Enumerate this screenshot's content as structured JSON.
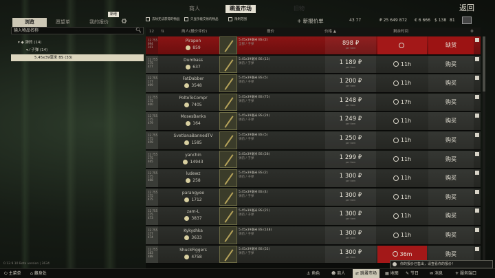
{
  "header": {
    "sub_tabs": [
      "浏览",
      "愿望单",
      "我的报价"
    ],
    "new_badge": "新增",
    "main_tabs": [
      "商人",
      "跳蚤市场",
      "旧物"
    ],
    "filters": [
      "去除无法获得的物品",
      "只显示能交易的物品",
      "限制范围"
    ],
    "wishlist_label": "新报价单",
    "currency": [
      "43 77",
      "₽ 25 649 872",
      "€ 6 666",
      "$ 138",
      "81"
    ],
    "back_label": "返回"
  },
  "sidebar": {
    "search_placeholder": "输入物品名称",
    "tree": [
      {
        "label": "弹药 (14)"
      },
      {
        "label": "子弹 (14)"
      },
      {
        "label": "5.45x39毫米 BS (33)"
      }
    ],
    "version": "0.12.9.10 Beta version | 3634"
  },
  "table": {
    "headers": {
      "level": "12",
      "seller": "商人(报价评价)",
      "item": "报价",
      "price": "价格 ▲",
      "expiry": "剩余时间"
    },
    "rows": [
      {
        "seller": "Pirapon",
        "rep": "859",
        "item": "5.45x39毫米 BS (2)",
        "sub": "全部 / 子弹",
        "price": "898 ₽",
        "time": "",
        "action": "缺货",
        "mine": true,
        "lvl": "12 755 694 101"
      },
      {
        "seller": "Dumbass",
        "rep": "637",
        "item": "5.45x39毫米 BS (13)",
        "sub": "弹药 / 子弹",
        "price": "1 189 ₽",
        "time": "11h",
        "action": "购买",
        "mine": false,
        "lvl": "12 755 175 477"
      },
      {
        "seller": "FatDabber",
        "rep": "3548",
        "item": "5.45x39毫米 BS (5)",
        "sub": "弹药 / 子弹",
        "price": "1 200 ₽",
        "time": "11h",
        "action": "购买",
        "mine": false,
        "lvl": "12 755 177 499"
      },
      {
        "seller": "PoltoToCompr",
        "rep": "7405",
        "item": "5.45x39毫米 BS (75)",
        "sub": "弹药 / 子弹",
        "price": "1 248 ₽",
        "time": "17h",
        "action": "购买",
        "mine": false,
        "lvl": "12 755 175 400"
      },
      {
        "seller": "MosesBanks",
        "rep": "164",
        "item": "5.45x39毫米 BS (24)",
        "sub": "弹药 / 子弹",
        "price": "1 249 ₽",
        "time": "11h",
        "action": "购买",
        "mine": false,
        "lvl": "12 755 175 479"
      },
      {
        "seller": "SvetlanaBannedTV",
        "rep": "1585",
        "item": "5.45x39毫米 BS (5)",
        "sub": "弹药 / 子弹",
        "price": "1 250 ₽",
        "time": "11h",
        "action": "购买",
        "mine": false,
        "lvl": "12 755 175 459"
      },
      {
        "seller": "yanchin",
        "rep": "14943",
        "item": "5.45x39毫米 BS (28)",
        "sub": "弹药 / 子弹",
        "price": "1 299 ₽",
        "time": "11h",
        "action": "购买",
        "mine": false,
        "lvl": "12 755 175 465"
      },
      {
        "seller": "ludewz",
        "rep": "258",
        "item": "5.45x39毫米 BS (2)",
        "sub": "弹药 / 子弹",
        "price": "1 300 ₽",
        "time": "11h",
        "action": "购买",
        "mine": false,
        "lvl": "12 755 175 468"
      },
      {
        "seller": "parangyee",
        "rep": "1712",
        "item": "5.45x39毫米 BS (4)",
        "sub": "弹药 / 子弹",
        "price": "1 300 ₽",
        "time": "11h",
        "action": "购买",
        "mine": false,
        "lvl": "12 755 175 475"
      },
      {
        "seller": "zam-L",
        "rep": "3837",
        "item": "5.45x39毫米 BS (21)",
        "sub": "弹药 / 子弹",
        "price": "1 300 ₽",
        "time": "11h",
        "action": "购买",
        "mine": false,
        "lvl": "12 755 175 473"
      },
      {
        "seller": "Kykyshka",
        "rep": "3633",
        "item": "5.45x39毫米 BS (148)",
        "sub": "弹药 / 子弹",
        "price": "1 300 ₽",
        "time": "11h",
        "action": "购买",
        "mine": false,
        "lvl": "12 755 177 474"
      },
      {
        "seller": "ShuckFiggers",
        "rep": "4758",
        "item": "5.45x39毫米 BS (52)",
        "sub": "弹药 / 子弹",
        "price": "1 300 ₽",
        "time": "36m",
        "action": "购买",
        "mine": false,
        "expiring": true,
        "lvl": "12 755 183 488"
      }
    ]
  },
  "notice": "你的报价已售出，请查看你的报价！",
  "bottombar": {
    "items": [
      "主菜单",
      "藏身处",
      "角色",
      "商人",
      "跳蚤市场",
      "地图",
      "节日",
      "消息",
      "服务端口"
    ]
  }
}
